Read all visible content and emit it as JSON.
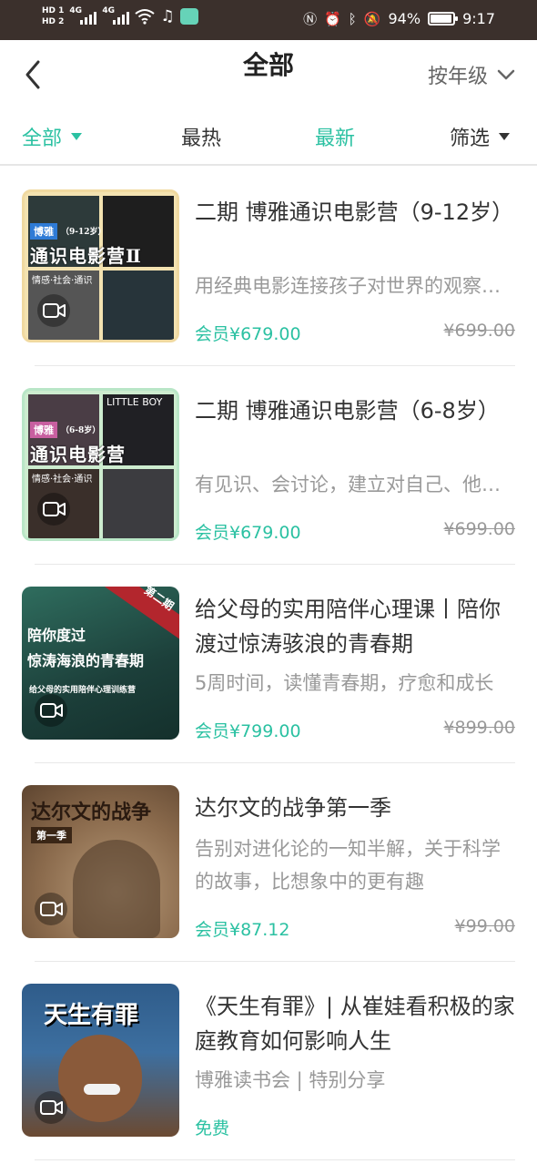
{
  "status_bar": {
    "hd1": "HD 1",
    "hd2": "HD 2",
    "net1": "4G",
    "net2": "4G",
    "battery_percent": "94%",
    "battery_level": 0.94,
    "time": "9:17",
    "icons": [
      "nfc-icon",
      "alarm-icon",
      "bluetooth-icon",
      "mute-icon"
    ]
  },
  "header": {
    "title": "全部",
    "grade_filter": "按年级"
  },
  "tabs": [
    {
      "label": "全部"
    },
    {
      "label": "最热"
    },
    {
      "label": "最新"
    },
    {
      "label": "筛选"
    }
  ],
  "courses": [
    {
      "title": "二期 博雅通识电影营（9-12岁）",
      "desc": "用经典电影连接孩子对世界的观察与思考",
      "price": "会员¥679.00",
      "original_price": "¥699.00",
      "thumb": {
        "brand": "博雅",
        "age": "（9-12岁）",
        "name": "通识电影营Ⅱ",
        "tags": "情感·社会·通识"
      }
    },
    {
      "title": "二期 博雅通识电影营（6-8岁）",
      "desc": "有见识、会讨论，建立对自己、他人与世界的理解",
      "price": "会员¥679.00",
      "original_price": "¥699.00",
      "thumb": {
        "brand": "博雅",
        "age": "（6-8岁）",
        "name": "通识电影营",
        "tags": "情感·社会·通识",
        "poster": "LITTLE BOY"
      }
    },
    {
      "title": "给父母的实用陪伴心理课丨陪你渡过惊涛骇浪的青春期",
      "desc": "5周时间，读懂青春期，疗愈和成长",
      "price": "会员¥799.00",
      "original_price": "¥899.00",
      "thumb": {
        "ribbon": "第二期",
        "line1": "陪你度过",
        "line2": "惊涛海浪的青春期",
        "line3": "给父母的实用陪伴心理训练营"
      }
    },
    {
      "title": "达尔文的战争第一季",
      "desc": "告别对进化论的一知半解，关于科学的故事，比想象中的更有趣",
      "price": "会员¥87.12",
      "original_price": "¥99.00",
      "thumb": {
        "name": "达尔文的战争",
        "season": "第一季"
      }
    },
    {
      "title": "《天生有罪》| 从崔娃看积极的家庭教育如何影响人生",
      "desc": "博雅读书会 | 特别分享",
      "price": "免费",
      "original_price": "",
      "thumb": {
        "name": "天生有罪"
      }
    }
  ],
  "colors": {
    "accent": "#2bc1a2",
    "status_bar": "#3b302c"
  }
}
